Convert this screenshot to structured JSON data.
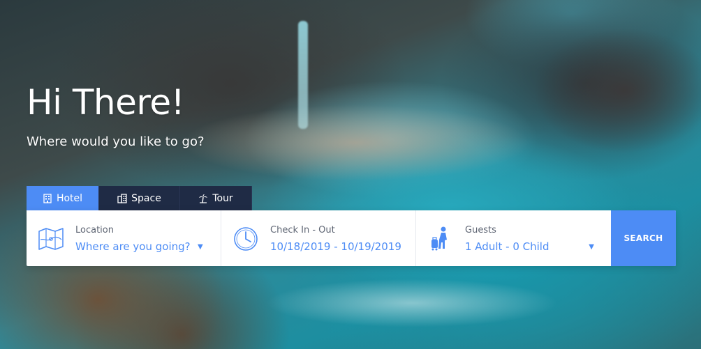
{
  "hero": {
    "title": "Hi There!",
    "subtitle": "Where would you like to go?"
  },
  "tabs": [
    {
      "label": "Hotel",
      "icon": "building-icon",
      "active": true
    },
    {
      "label": "Space",
      "icon": "office-building-icon",
      "active": false
    },
    {
      "label": "Tour",
      "icon": "palm-tree-icon",
      "active": false
    }
  ],
  "search": {
    "location": {
      "label": "Location",
      "value": "Where are you going?",
      "icon": "map-icon"
    },
    "dates": {
      "label": "Check In - Out",
      "value": "10/18/2019 - 10/19/2019",
      "icon": "clock-icon"
    },
    "guests": {
      "label": "Guests",
      "value": "1 Adult - 0 Child",
      "icon": "traveler-icon"
    },
    "button": "SEARCH"
  },
  "colors": {
    "accent": "#4d8cf5",
    "tab_inactive": "#1f2b45",
    "label_text": "#5e6573"
  }
}
